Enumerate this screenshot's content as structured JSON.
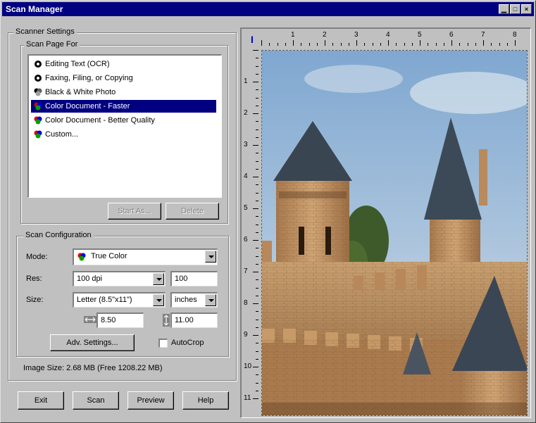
{
  "window": {
    "title": "Scan Manager"
  },
  "scanner_settings": {
    "group_label": "Scanner Settings",
    "scan_page_for": {
      "group_label": "Scan Page For",
      "items": [
        {
          "label": "Editing Text (OCR)",
          "icon": "bw-icon"
        },
        {
          "label": "Faxing, Filing, or Copying",
          "icon": "bw-icon"
        },
        {
          "label": "Black & White Photo",
          "icon": "gray-icon"
        },
        {
          "label": "Color Document - Faster",
          "icon": "color-icon",
          "selected": true
        },
        {
          "label": "Color Document - Better Quality",
          "icon": "color-icon"
        },
        {
          "label": "Custom...",
          "icon": "color-icon"
        }
      ],
      "start_as_label": "Start As...",
      "delete_label": "Delete"
    },
    "scan_configuration": {
      "group_label": "Scan Configuration",
      "mode_label": "Mode:",
      "mode_value": "True Color",
      "res_label": "Res:",
      "res_value": "100 dpi",
      "res_custom": "100",
      "size_label": "Size:",
      "size_value": "Letter (8.5\"x11\")",
      "units_value": "inches",
      "width_value": "8.50",
      "height_value": "11.00",
      "adv_settings_label": "Adv. Settings...",
      "autocrop_label": "AutoCrop",
      "autocrop_checked": false
    },
    "image_size": "Image Size: 2.68 MB (Free 1208.22 MB)"
  },
  "buttons": {
    "exit": "Exit",
    "scan": "Scan",
    "preview": "Preview",
    "help": "Help"
  },
  "ruler": {
    "horizontal": [
      "1",
      "2",
      "3",
      "4",
      "5",
      "6",
      "7",
      "8"
    ],
    "vertical": [
      "1",
      "2",
      "3",
      "4",
      "5",
      "6",
      "7",
      "8",
      "9",
      "10",
      "11"
    ]
  },
  "colors": {
    "title_bar": "#000080",
    "selection": "#000080",
    "face": "#c0c0c0"
  }
}
